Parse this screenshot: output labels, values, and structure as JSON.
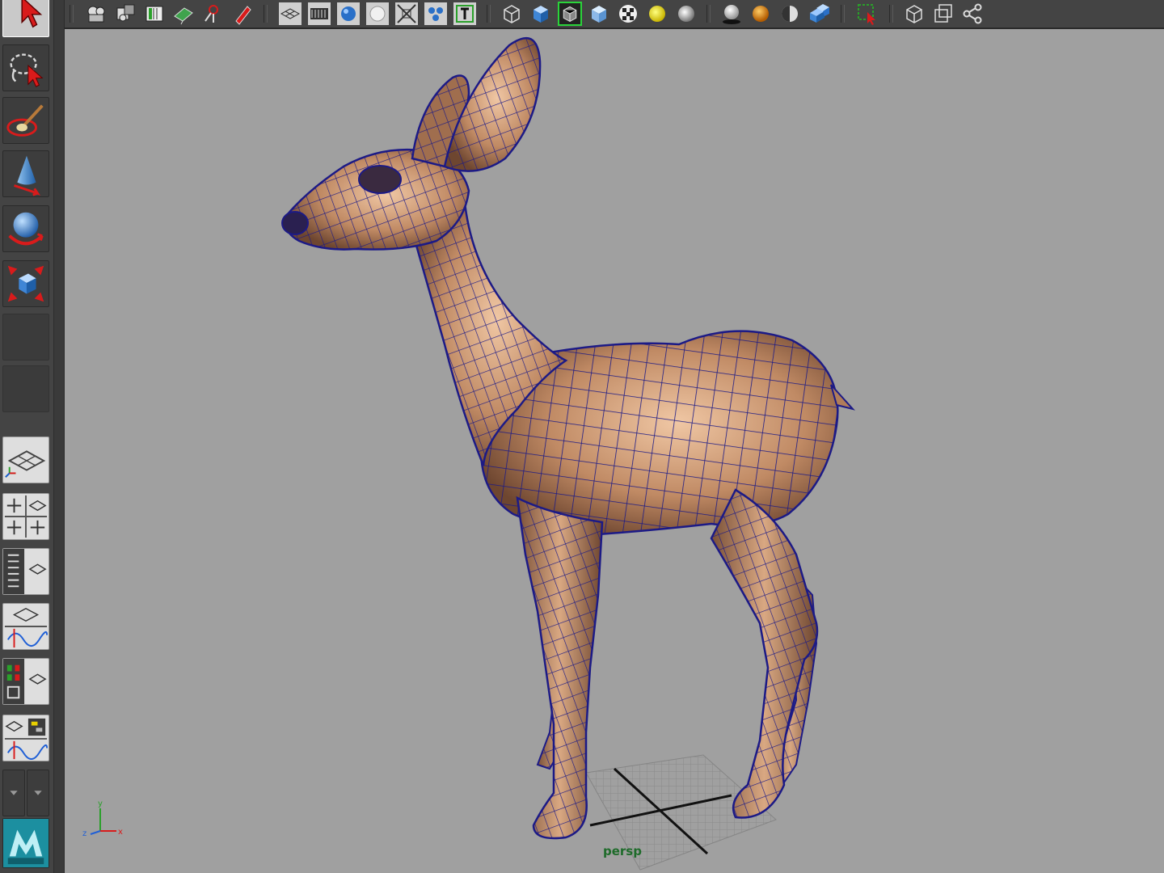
{
  "toolbox": {
    "tools": [
      {
        "name": "select-tool",
        "icon": "select-arrow-icon",
        "active": true
      },
      {
        "name": "lasso-tool",
        "icon": "lasso-icon"
      },
      {
        "name": "paint-select-tool",
        "icon": "paint-brush-icon"
      },
      {
        "name": "move-tool",
        "icon": "cone-move-icon"
      },
      {
        "name": "rotate-tool",
        "icon": "sphere-rotate-icon"
      },
      {
        "name": "scale-tool",
        "icon": "cube-scale-icon"
      },
      {
        "name": "last-used-tool",
        "icon": "empty-slot"
      }
    ],
    "layouts": [
      {
        "name": "single-perspective-layout",
        "icon": "grid-plane-icon"
      },
      {
        "name": "four-view-layout",
        "icon": "four-panes-icon"
      },
      {
        "name": "outliner-persp-layout",
        "icon": "outliner-persp-icon"
      },
      {
        "name": "persp-graph-layout",
        "icon": "graph-editor-icon"
      },
      {
        "name": "hypershade-persp-layout",
        "icon": "hypershade-icon"
      },
      {
        "name": "persp-graph-hypergraph-layout",
        "icon": "graph-hypergraph-icon"
      }
    ]
  },
  "shelf": {
    "icons": [
      "camera-attributes-icon",
      "camera-tools-icon",
      "bookmarks-icon",
      "image-plane-icon",
      "2d-pan-zoom-icon",
      "grease-pencil-icon",
      "grid-icon",
      "film-gate-icon",
      "resolution-gate-icon",
      "gate-mask-icon",
      "field-chart-icon",
      "safe-action-icon",
      "safe-title-icon",
      "wireframe-icon",
      "smooth-shade-icon",
      "wireframe-on-shaded-icon",
      "xray-icon",
      "textured-icon",
      "use-default-light-icon",
      "all-lights-icon",
      "shadows-icon",
      "screen-space-ao-icon",
      "motion-blur-icon",
      "antialiasing-icon",
      "isolate-select-icon",
      "xray-joints-icon",
      "xray-active-icon",
      "hud-icon"
    ]
  },
  "viewport": {
    "camera_label": "persp",
    "background_color": "#a0a0a0",
    "model": "deer",
    "display_mode": "wireframe-on-shaded",
    "wire_color": "#1c1a86",
    "skin_color": "#c08a64",
    "axis_labels": {
      "x": "x",
      "y": "y",
      "z": "z"
    }
  },
  "branding": {
    "logo": "maya-logo-icon"
  }
}
